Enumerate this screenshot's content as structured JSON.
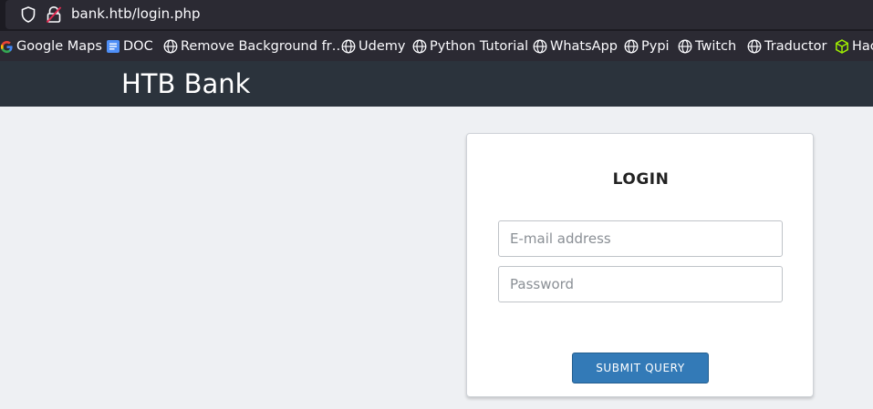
{
  "browser": {
    "url": "bank.htb/login.php"
  },
  "bookmarks": [
    {
      "label": "Google Maps",
      "icon": "google-icon"
    },
    {
      "label": "DOC",
      "icon": "doc-icon"
    },
    {
      "label": "Remove Background fr…",
      "icon": "globe-icon"
    },
    {
      "label": "Udemy",
      "icon": "globe-icon"
    },
    {
      "label": "Python Tutorial",
      "icon": "globe-icon"
    },
    {
      "label": "WhatsApp",
      "icon": "globe-icon"
    },
    {
      "label": "Pypi",
      "icon": "globe-icon"
    },
    {
      "label": "Twitch",
      "icon": "globe-icon"
    },
    {
      "label": "Traductor",
      "icon": "globe-icon"
    },
    {
      "label": "Hac",
      "icon": "cube-icon"
    }
  ],
  "site": {
    "brand": "HTB Bank"
  },
  "login": {
    "title": "LOGIN",
    "email_placeholder": "E-mail address",
    "email_value": "",
    "password_placeholder": "Password",
    "password_value": "",
    "submit_label": "Submit Query"
  },
  "colors": {
    "header_bg": "#2b333c",
    "page_bg": "#eef0f3",
    "button_bg": "#337ab7"
  }
}
